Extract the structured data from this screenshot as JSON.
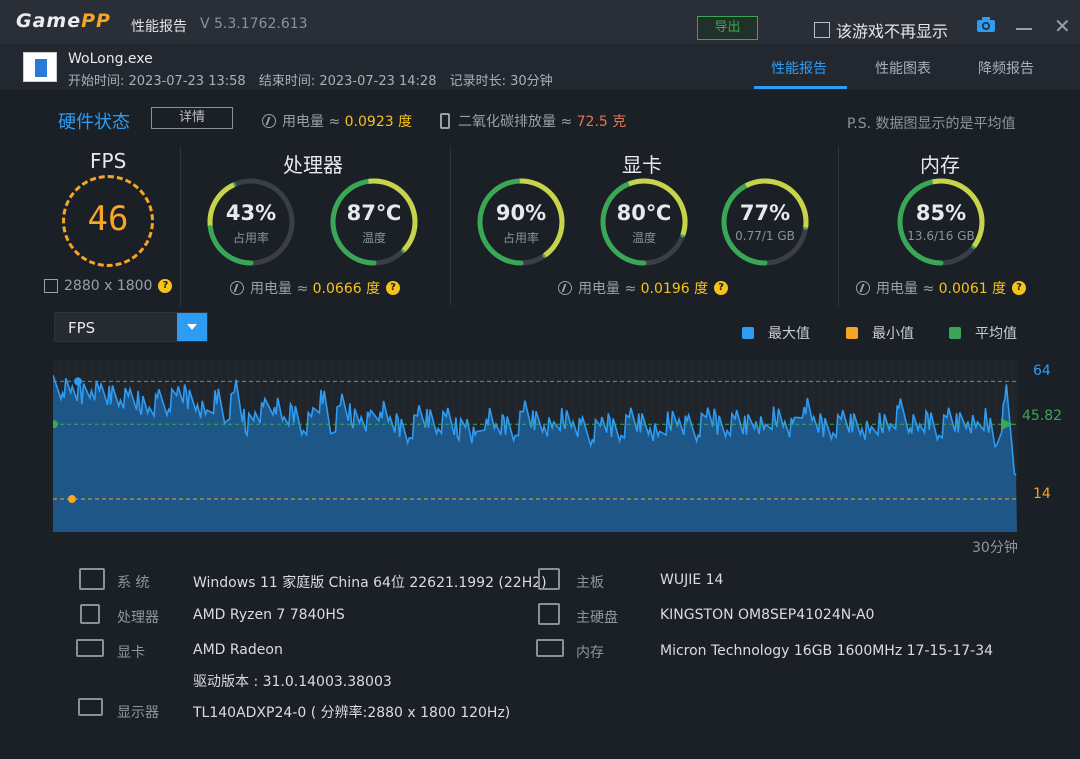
{
  "app": {
    "logo_a": "Game",
    "logo_b": "PP",
    "title": "性能报告",
    "version": "V 5.3.1762.613",
    "export_label": "导出",
    "noshow_label": "该游戏不再显示",
    "close": "✕"
  },
  "session": {
    "exe": "WoLong.exe",
    "start": "开始时间: 2023-07-23 13:58",
    "end": "结束时间: 2023-07-23 14:28",
    "duration": "记录时长: 30分钟"
  },
  "tabs": [
    "性能报告",
    "性能图表",
    "降频报告"
  ],
  "hardware": {
    "title": "硬件状态",
    "detail_label": "详情",
    "power_label": "用电量 ≈",
    "power_value": "0.0923 度",
    "co2_label": "二氧化碳排放量 ≈",
    "co2_value": "72.5 克",
    "ps": "P.S. 数据图显示的是平均值"
  },
  "sections": {
    "fps": "FPS",
    "cpu": "处理器",
    "gpu": "显卡",
    "mem": "内存"
  },
  "fps": {
    "value": "46",
    "resolution": "2880 x 1800"
  },
  "gauges": [
    {
      "value": "43%",
      "sub": "占用率",
      "pct": 0.43,
      "color": "#c9d34a"
    },
    {
      "value": "87℃",
      "sub": "温度",
      "pct": 0.87,
      "color": "#c9d34a"
    },
    {
      "value": "90%",
      "sub": "占用率",
      "pct": 0.9,
      "color": "#c9d34a"
    },
    {
      "value": "80℃",
      "sub": "温度",
      "pct": 0.8,
      "color": "#c9d34a"
    },
    {
      "value": "77%",
      "sub": "0.77/1 GB",
      "pct": 0.77,
      "color": "#c9d34a"
    },
    {
      "value": "85%",
      "sub": "13.6/16 GB",
      "pct": 0.85,
      "color": "#c9d34a"
    }
  ],
  "power": {
    "label": "用电量 ≈",
    "cpu": "0.0666 度",
    "gpu": "0.0196 度",
    "mem": "0.0061 度"
  },
  "chart_select": "FPS",
  "legend": [
    {
      "label": "最大值",
      "color": "#2e9cf2"
    },
    {
      "label": "最小值",
      "color": "#f6a623"
    },
    {
      "label": "平均值",
      "color": "#3aa757"
    }
  ],
  "chart_data": {
    "type": "area",
    "series": [
      {
        "name": "FPS",
        "values": [
          62,
          61,
          60,
          59,
          61,
          60,
          58,
          56,
          57,
          55,
          52,
          56,
          54,
          60,
          57,
          55,
          49,
          58,
          47,
          61,
          45,
          50,
          52,
          55,
          47,
          51,
          44,
          50,
          58,
          42,
          55,
          49,
          48,
          47,
          53,
          47,
          45,
          41,
          51,
          48,
          44,
          49,
          43,
          47,
          38,
          50,
          44,
          46,
          42,
          53,
          47,
          45,
          43,
          49,
          46,
          44,
          41,
          47,
          45,
          42,
          50,
          46,
          44,
          39,
          48,
          47,
          45,
          43,
          51,
          46,
          44,
          49,
          45,
          47,
          42,
          50,
          46,
          44,
          55,
          47,
          45,
          43,
          49,
          46,
          44,
          41,
          47,
          45,
          52,
          46,
          44,
          48,
          42,
          50,
          46,
          47,
          43,
          49,
          36,
          58,
          24
        ]
      }
    ],
    "max": 64,
    "avg": 45.82,
    "min": 14,
    "duration_label": "30分钟"
  },
  "specs": [
    {
      "label": "系  统",
      "value": "Windows 11 家庭版 China 64位 22621.1992 (22H2)"
    },
    {
      "label": "处理器",
      "value": "AMD Ryzen 7 7840HS"
    },
    {
      "label": "显卡",
      "value": "AMD Radeon"
    },
    {
      "label": "",
      "value": "驱动版本 : 31.0.14003.38003"
    },
    {
      "label": "显示器",
      "value": "TL140ADXP24-0 ( 分辨率:2880 x 1800 120Hz)"
    },
    {
      "label": "主板",
      "value": "WUJIE 14"
    },
    {
      "label": "主硬盘",
      "value": "KINGSTON OM8SEP41024N-A0"
    },
    {
      "label": "内存",
      "value": "Micron Technology 16GB 1600MHz 17-15-17-34"
    }
  ]
}
